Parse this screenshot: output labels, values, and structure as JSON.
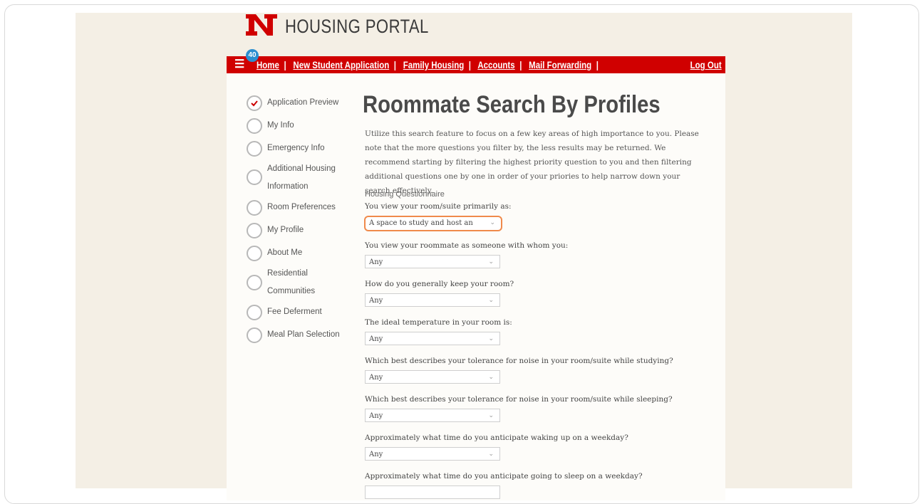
{
  "brand": {
    "title": "HOUSING PORTAL",
    "accent": "#d00000"
  },
  "nav": {
    "menu_icon": "hamburger-icon",
    "badge": "40",
    "links": [
      "Home",
      "New Student Application",
      "Family Housing",
      "Accounts",
      "Mail Forwarding"
    ],
    "logout": "Log Out"
  },
  "sidebar": {
    "items": [
      {
        "label": "Application Preview"
      },
      {
        "label": "My Info"
      },
      {
        "label": "Emergency Info"
      },
      {
        "label1": "Additional Housing",
        "label2": "Information"
      },
      {
        "label": "Room Preferences"
      },
      {
        "label": "My Profile"
      },
      {
        "label": "About Me"
      },
      {
        "label1": "Residential",
        "label2": "Communities"
      },
      {
        "label": "Fee Deferment"
      },
      {
        "label": "Meal Plan Selection"
      }
    ]
  },
  "main": {
    "title": "Roommate Search By Profiles",
    "intro": "Utilize this search feature to focus on a few key areas of high importance to you. Please note that the more questions you filter by, the less results may be returned. We recommend starting by filtering the highest priority question to you and then filtering additional questions one by one in order of your priories to help narrow down your search effectively.",
    "section": "Housing Questionnaire",
    "questions": [
      {
        "label": "You view your room/suite primarily as:",
        "value": "A space to study and host an"
      },
      {
        "label": "You view your roommate as someone with whom you:",
        "value": "Any"
      },
      {
        "label": "How do you generally keep your room?",
        "value": "Any"
      },
      {
        "label": "The ideal temperature in your room is:",
        "value": "Any"
      },
      {
        "label": "Which best describes your tolerance for noise in your room/suite while studying?",
        "value": "Any"
      },
      {
        "label": "Which best describes your tolerance for noise in your room/suite while sleeping?",
        "value": "Any"
      },
      {
        "label": "Approximately what time do you anticipate waking up on a weekday?",
        "value": "Any"
      },
      {
        "label": "Approximately what time do you anticipate going to sleep on a weekday?",
        "value": ""
      }
    ]
  }
}
